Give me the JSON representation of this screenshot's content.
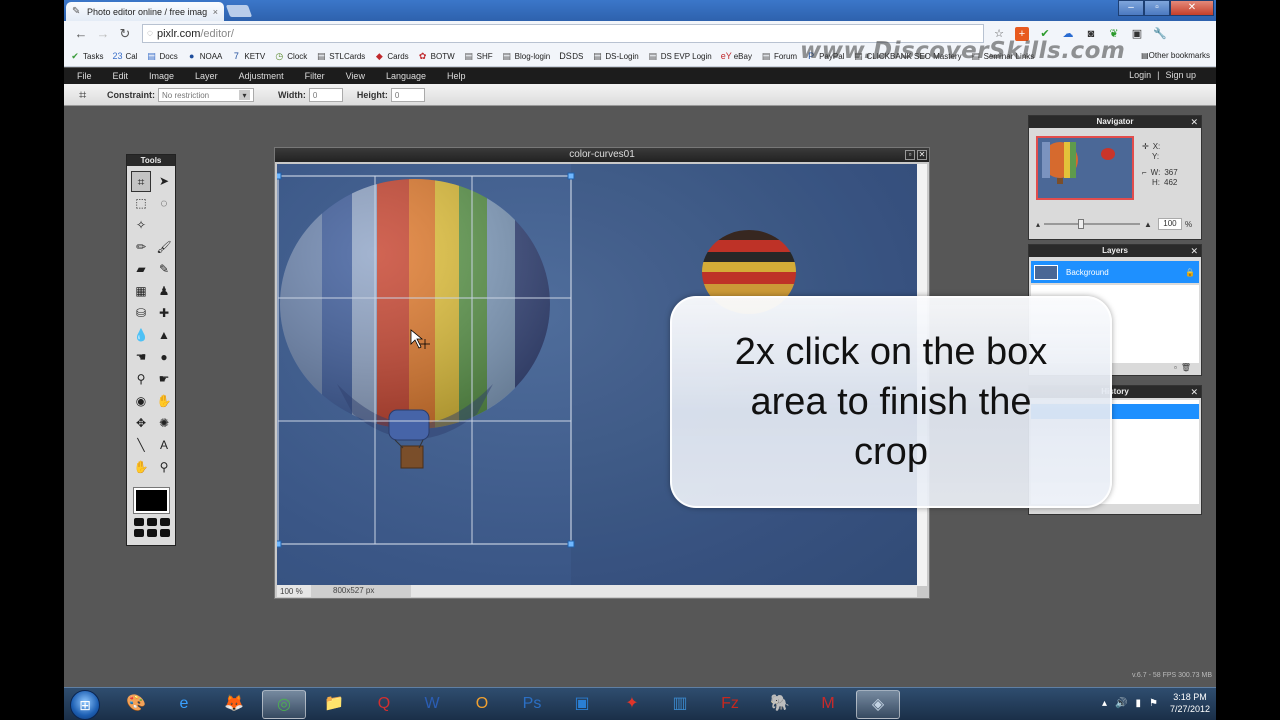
{
  "browser": {
    "tab_title": "Photo editor online / free imag",
    "tab_close": "×",
    "url_host": "pixlr.com",
    "url_path": "/editor/",
    "watermark": "www.DiscoverSkills.com",
    "bookmarks": [
      {
        "label": "Tasks",
        "icon": "✔",
        "color": "#3a9b3a"
      },
      {
        "label": "Cal",
        "icon": "23",
        "color": "#3b6fc9"
      },
      {
        "label": "Docs",
        "icon": "▤",
        "color": "#3b6fc9"
      },
      {
        "label": "NOAA",
        "icon": "●",
        "color": "#1d4c9b"
      },
      {
        "label": "KETV",
        "icon": "7",
        "color": "#1d4c9b"
      },
      {
        "label": "Clock",
        "icon": "◷",
        "color": "#5b8a2e"
      },
      {
        "label": "STLCards",
        "icon": "▤",
        "color": "#555"
      },
      {
        "label": "Cards",
        "icon": "◆",
        "color": "#c0282c"
      },
      {
        "label": "BOTW",
        "icon": "✿",
        "color": "#c0282c"
      },
      {
        "label": "SHF",
        "icon": "▤",
        "color": "#555"
      },
      {
        "label": "Blog-login",
        "icon": "▤",
        "color": "#555"
      },
      {
        "label": "DS",
        "icon": "DS",
        "color": "#222"
      },
      {
        "label": "DS-Login",
        "icon": "▤",
        "color": "#555"
      },
      {
        "label": "DS EVP Login",
        "icon": "▤",
        "color": "#555"
      },
      {
        "label": "eBay",
        "icon": "eY",
        "color": "#c0282c"
      },
      {
        "label": "Forum",
        "icon": "▤",
        "color": "#555"
      },
      {
        "label": "PayPal",
        "icon": "P",
        "color": "#1d4c9b"
      },
      {
        "label": "CLICKBANK SEO Mastery",
        "icon": "▤",
        "color": "#555"
      },
      {
        "label": "Seminar Links",
        "icon": "▤",
        "color": "#555"
      }
    ],
    "other_bookmarks": "Other bookmarks"
  },
  "menu": {
    "items": [
      "File",
      "Edit",
      "Image",
      "Layer",
      "Adjustment",
      "Filter",
      "View",
      "Language",
      "Help"
    ],
    "login": "Login",
    "separator": "|",
    "signup": "Sign up"
  },
  "tool_options": {
    "constraint_label": "Constraint:",
    "constraint_value": "No restriction",
    "width_label": "Width:",
    "width_value": "0",
    "height_label": "Height:",
    "height_value": "0"
  },
  "tools_panel": {
    "title": "Tools",
    "tools": [
      {
        "name": "crop-tool-icon",
        "glyph": "⌗",
        "active": true
      },
      {
        "name": "move-tool-icon",
        "glyph": "➤"
      },
      {
        "name": "marquee-tool-icon",
        "glyph": "⬚"
      },
      {
        "name": "lasso-tool-icon",
        "glyph": "◌"
      },
      {
        "name": "wand-tool-icon",
        "glyph": "✧"
      },
      {
        "name": "blank-tool",
        "glyph": ""
      },
      {
        "name": "pencil-tool-icon",
        "glyph": "✏"
      },
      {
        "name": "brush-tool-icon",
        "glyph": "🖌"
      },
      {
        "name": "eraser-tool-icon",
        "glyph": "▰"
      },
      {
        "name": "replace-tool-icon",
        "glyph": "✎"
      },
      {
        "name": "gradient-tool-icon",
        "glyph": "▦"
      },
      {
        "name": "stamp-tool-icon",
        "glyph": "♟"
      },
      {
        "name": "fill-tool-icon",
        "glyph": "⛁"
      },
      {
        "name": "spot-heal-tool-icon",
        "glyph": "✚"
      },
      {
        "name": "blur-tool-icon",
        "glyph": "💧"
      },
      {
        "name": "sharpen-tool-icon",
        "glyph": "▲"
      },
      {
        "name": "smudge-tool-icon",
        "glyph": "☚"
      },
      {
        "name": "sponge-tool-icon",
        "glyph": "●"
      },
      {
        "name": "burn-tool-icon",
        "glyph": "⚲"
      },
      {
        "name": "dodge-tool-icon",
        "glyph": "☛"
      },
      {
        "name": "redeye-tool-icon",
        "glyph": "◉"
      },
      {
        "name": "bloat-tool-icon",
        "glyph": "✋"
      },
      {
        "name": "pinch-tool-icon",
        "glyph": "✥"
      },
      {
        "name": "spherize-tool-icon",
        "glyph": "✺"
      },
      {
        "name": "eyedropper-tool-icon",
        "glyph": "╲"
      },
      {
        "name": "text-tool-icon",
        "glyph": "A"
      },
      {
        "name": "hand-tool-icon",
        "glyph": "✋"
      },
      {
        "name": "zoom-tool-icon",
        "glyph": "⚲"
      }
    ]
  },
  "document": {
    "title": "color-curves01",
    "zoom": "100 %",
    "size": "800x527 px"
  },
  "navigator": {
    "title": "Navigator",
    "x_label": "X:",
    "y_label": "Y:",
    "w_label": "W:",
    "w_value": "367",
    "h_label": "H:",
    "h_value": "462",
    "zoom_value": "100",
    "zoom_unit": "%"
  },
  "layers": {
    "title": "Layers",
    "layer_name": "Background"
  },
  "history": {
    "title": "History"
  },
  "callout": {
    "text": "2x click on the box area to finish the crop"
  },
  "version": "v.6.7 - 58 FPS 300.73 MB",
  "taskbar": {
    "apps": [
      {
        "name": "start-button",
        "glyph": "⊞"
      },
      {
        "name": "paint-app-icon",
        "glyph": "🎨"
      },
      {
        "name": "ie-app-icon",
        "glyph": "e"
      },
      {
        "name": "firefox-app-icon",
        "glyph": "🦊"
      },
      {
        "name": "chrome-app-icon",
        "glyph": "◎"
      },
      {
        "name": "explorer-app-icon",
        "glyph": "📁"
      },
      {
        "name": "quicken-app-icon",
        "glyph": "Q"
      },
      {
        "name": "word-app-icon",
        "glyph": "W"
      },
      {
        "name": "outlook-app-icon",
        "glyph": "O"
      },
      {
        "name": "photoshop-app-icon",
        "glyph": "Ps"
      },
      {
        "name": "capture-app-icon",
        "glyph": "▣"
      },
      {
        "name": "acrobat-app-icon",
        "glyph": "✦"
      },
      {
        "name": "editor-app-icon",
        "glyph": "▥"
      },
      {
        "name": "filezilla-app-icon",
        "glyph": "Fz"
      },
      {
        "name": "evernote-app-icon",
        "glyph": "🐘"
      },
      {
        "name": "mail-app-icon",
        "glyph": "M"
      },
      {
        "name": "camtasia-app-icon",
        "glyph": "◈"
      }
    ],
    "time": "3:18 PM",
    "date": "7/27/2012"
  }
}
